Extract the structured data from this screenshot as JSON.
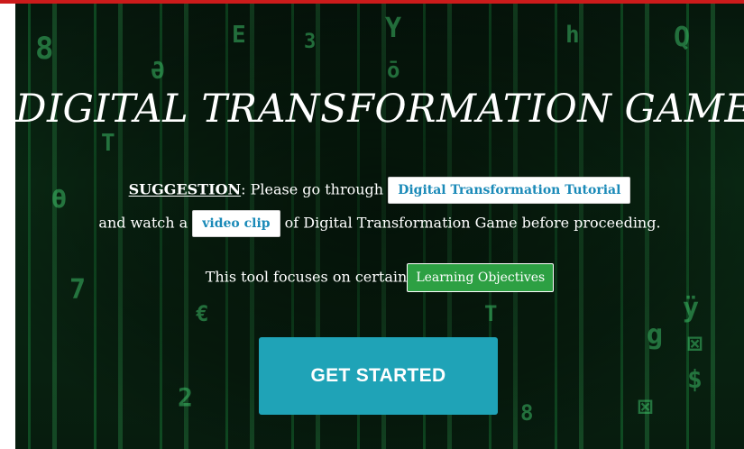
{
  "page": {
    "title": "DIGITAL TRANSFORMATION GAME",
    "suggestion_label": "SUGGESTION",
    "suggestion_text_1": ": Please go through",
    "tutorial_link": "Digital Transformation Tutorial",
    "suggestion_text_2": "and watch a",
    "video_link": "video clip",
    "suggestion_text_3": "of Digital Transformation Game before proceeding.",
    "objectives_text": "This tool focuses on certain",
    "objectives_link": "Learning Objectives",
    "cta_label": "GET STARTED"
  },
  "colors": {
    "top_bar": "#cc1b1b",
    "tutorial_chip_text": "#1a8ab8",
    "objectives_chip": "#2da043",
    "cta_button": "#1fa3b7"
  }
}
